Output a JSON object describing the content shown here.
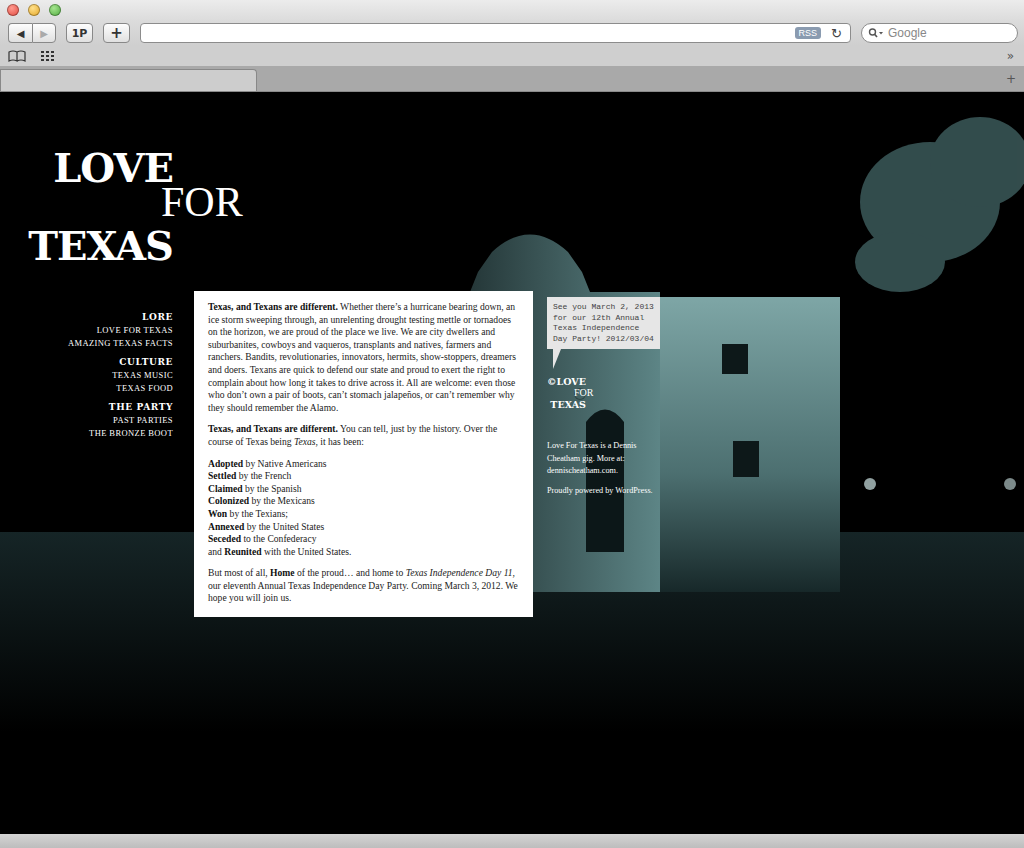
{
  "browser": {
    "toolbar": {
      "back": {
        "label": "◀",
        "disabled": false
      },
      "forward": {
        "label": "▶",
        "disabled": true
      },
      "onepassword": "1P",
      "add_bookmark": "+",
      "rss": "RSS",
      "reload": "↻"
    },
    "search": {
      "placeholder": "Google"
    },
    "bookmarks_bar": {
      "overflow": "»"
    },
    "tabs": [
      {
        "label": "",
        "selected": true
      }
    ],
    "new_tab": "+"
  },
  "site": {
    "logo": [
      {
        "text": "LOVE",
        "kind": "heavy"
      },
      {
        "text": "FOR",
        "kind": "light"
      },
      {
        "text": "TEXAS",
        "kind": "heavy"
      }
    ],
    "nav": [
      {
        "heading": "LORE",
        "items": [
          "LOVE FOR TEXAS",
          "AMAZING TEXAS FACTS"
        ]
      },
      {
        "heading": "CULTURE",
        "items": [
          "TEXAS MUSIC",
          "TEXAS FOOD"
        ]
      },
      {
        "heading": "THE PARTY",
        "items": [
          "PAST PARTIES",
          "THE BRONZE BOOT"
        ]
      }
    ],
    "article": {
      "paragraphs": [
        [
          {
            "t": "Texas, and Texans are different.",
            "s": "b"
          },
          {
            "t": " Whether there’s a hurricane bearing down, an ice storm sweeping through, an unrelenting drought testing mettle or tornadoes on the horizon, we are proud of the place we live. We are city dwellers and suburbanites, cowboys and vaqueros, transplants and natives, farmers and ranchers. Bandits, revolutionaries, innovators, hermits, show-stoppers, dreamers and doers. Texans are quick to defend our state and proud to exert the right to complain about how long it takes to drive across it. All are welcome: even those who don’t own a pair of boots, can’t stomach jalapeños, or can’t remember why they should remember the Alamo.",
            "s": "p"
          }
        ],
        [
          {
            "t": "Texas, and Texans are different.",
            "s": "b"
          },
          {
            "t": " You can tell, just by the history. Over the course of Texas being ",
            "s": "p"
          },
          {
            "t": "Texas",
            "s": "i"
          },
          {
            "t": ", it has been:",
            "s": "p"
          }
        ]
      ],
      "history": [
        [
          {
            "t": "Adopted",
            "s": "b"
          },
          {
            "t": " by Native Americans",
            "s": "p"
          }
        ],
        [
          {
            "t": "Settled",
            "s": "b"
          },
          {
            "t": " by the French",
            "s": "p"
          }
        ],
        [
          {
            "t": "Claimed",
            "s": "b"
          },
          {
            "t": " by the Spanish",
            "s": "p"
          }
        ],
        [
          {
            "t": "Colonized",
            "s": "b"
          },
          {
            "t": " by the Mexicans",
            "s": "p"
          }
        ],
        [
          {
            "t": "Won",
            "s": "b"
          },
          {
            "t": " by the Texians;",
            "s": "p"
          }
        ],
        [
          {
            "t": "Annexed",
            "s": "b"
          },
          {
            "t": " by the United States",
            "s": "p"
          }
        ],
        [
          {
            "t": "Seceded",
            "s": "b"
          },
          {
            "t": " to the Confederacy",
            "s": "p"
          }
        ],
        [
          {
            "t": "and ",
            "s": "p"
          },
          {
            "t": "Reunited",
            "s": "b"
          },
          {
            "t": " with the United States.",
            "s": "p"
          }
        ]
      ],
      "closing": [
        {
          "t": "But most of all, ",
          "s": "p"
        },
        {
          "t": "Home",
          "s": "b"
        },
        {
          "t": " of the proud… and home to ",
          "s": "p"
        },
        {
          "t": "Texas Independence Day 11",
          "s": "i"
        },
        {
          "t": ", our eleventh Annual Texas Independence Day Party. Coming March 3, 2012. We hope you will join us.",
          "s": "p"
        }
      ]
    },
    "tweet": "See you March 2, 2013 for our 12th Annual Texas Independence Day Party! 2012/03/04",
    "small_logo": [
      {
        "text": "©LOVE",
        "kind": "heavy"
      },
      {
        "text": "FOR",
        "kind": "light"
      },
      {
        "text": "TEXAS",
        "kind": "heavy"
      }
    ],
    "footer": [
      "Love For Texas is a Dennis Cheatham gig. More at: dennischeatham.com.",
      "Proudly powered by WordPress."
    ]
  }
}
